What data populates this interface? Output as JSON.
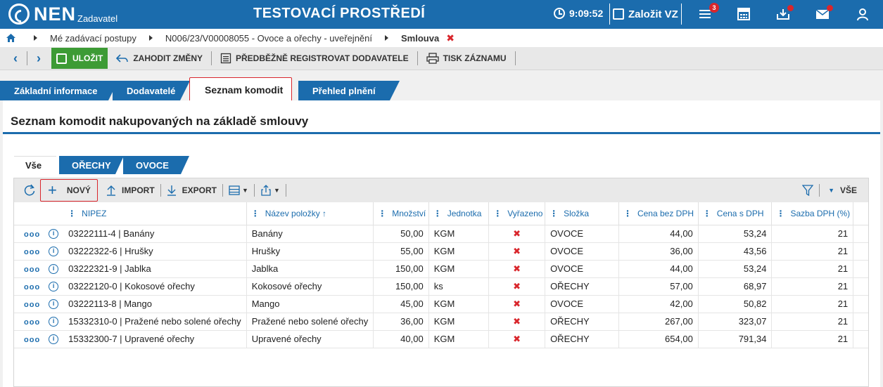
{
  "app": {
    "logo_text": "NEN",
    "logo_sub": "Zadavatel",
    "env_title": "TESTOVACÍ PROSTŘEDÍ",
    "clock": "9:09:52",
    "create_label": "Založit VZ",
    "menu_badge": "3",
    "accent_color": "#1b6cad",
    "alert_color": "#d9262c"
  },
  "breadcrumb": {
    "items": [
      "Mé zadávací postupy",
      "N006/23/V00008055 - Ovoce a ořechy - uveřejnění",
      "Smlouva"
    ],
    "close_glyph": "✖"
  },
  "toolbar": {
    "save_label": "ULOŽIT",
    "discard_label": "ZAHODIT ZMĚNY",
    "preregister_label": "PŘEDBĚŽNĚ REGISTROVAT DODAVATELE",
    "print_label": "TISK ZÁZNAMU"
  },
  "main_tabs": [
    "Základní informace",
    "Dodavatelé",
    "Seznam komodit",
    "Přehled plnění"
  ],
  "panel": {
    "title": "Seznam komodit nakupovaných na základě smlouvy"
  },
  "sub_tabs": [
    "Vše",
    "OŘECHY",
    "OVOCE"
  ],
  "grid": {
    "new_label": "NOVÝ",
    "import_label": "IMPORT",
    "export_label": "EXPORT",
    "filter_all_label": "VŠE",
    "columns": [
      "NIPEZ",
      "Název položky ↑",
      "Množství",
      "Jednotka",
      "Vyřazeno",
      "Složka",
      "Cena bez DPH",
      "Cena s DPH",
      "Sazba DPH (%)"
    ],
    "rows": [
      {
        "nipez": "03222111-4 | Banány",
        "name": "Banány",
        "qty": "50,00",
        "unit": "KGM",
        "removed": "✖",
        "folder": "OVOCE",
        "price": "44,00",
        "price_vat": "53,24",
        "vat": "21"
      },
      {
        "nipez": "03222322-6 | Hrušky",
        "name": "Hrušky",
        "qty": "55,00",
        "unit": "KGM",
        "removed": "✖",
        "folder": "OVOCE",
        "price": "36,00",
        "price_vat": "43,56",
        "vat": "21"
      },
      {
        "nipez": "03222321-9 | Jablka",
        "name": "Jablka",
        "qty": "150,00",
        "unit": "KGM",
        "removed": "✖",
        "folder": "OVOCE",
        "price": "44,00",
        "price_vat": "53,24",
        "vat": "21"
      },
      {
        "nipez": "03222120-0 | Kokosové ořechy",
        "name": "Kokosové ořechy",
        "qty": "150,00",
        "unit": "ks",
        "removed": "✖",
        "folder": "OŘECHY",
        "price": "57,00",
        "price_vat": "68,97",
        "vat": "21"
      },
      {
        "nipez": "03222113-8 | Mango",
        "name": "Mango",
        "qty": "45,00",
        "unit": "KGM",
        "removed": "✖",
        "folder": "OVOCE",
        "price": "42,00",
        "price_vat": "50,82",
        "vat": "21"
      },
      {
        "nipez": "15332310-0 | Pražené nebo solené ořechy",
        "name": "Pražené nebo solené ořechy",
        "qty": "36,00",
        "unit": "KGM",
        "removed": "✖",
        "folder": "OŘECHY",
        "price": "267,00",
        "price_vat": "323,07",
        "vat": "21"
      },
      {
        "nipez": "15332300-7 | Upravené ořechy",
        "name": "Upravené ořechy",
        "qty": "40,00",
        "unit": "KGM",
        "removed": "✖",
        "folder": "OŘECHY",
        "price": "654,00",
        "price_vat": "791,34",
        "vat": "21"
      }
    ]
  }
}
